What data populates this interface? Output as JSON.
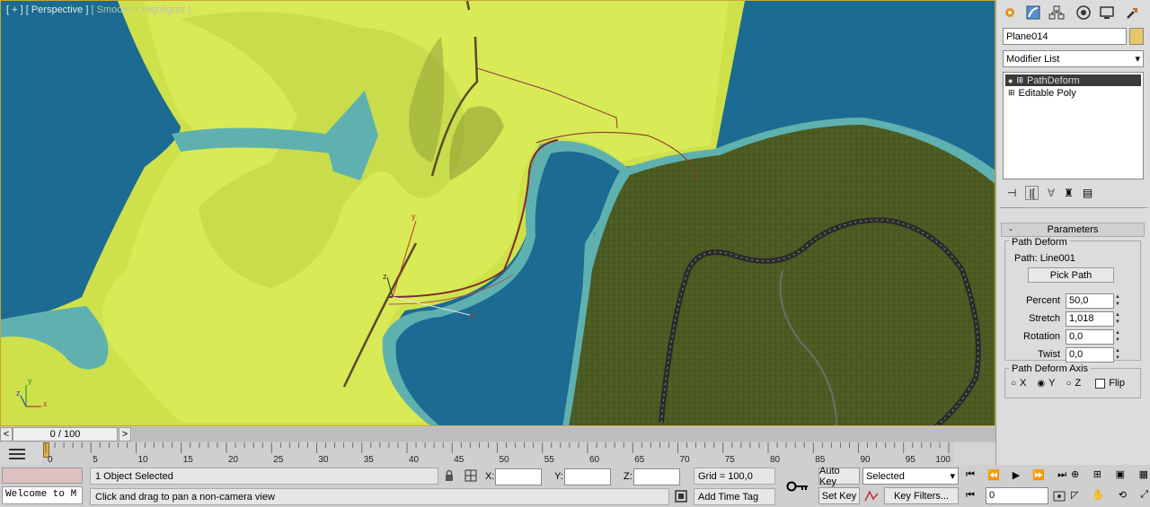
{
  "viewport": {
    "label_plus": "[ + ]",
    "label_view": "[ Perspective ]",
    "label_shading": "[ Smooth + Highlights ]",
    "axis": {
      "x": "x",
      "y": "y",
      "z": "z"
    },
    "gizmo": {
      "x": "x",
      "y": "y",
      "z": "z"
    }
  },
  "command_panel": {
    "object_name": "Plane014",
    "object_color": "#e6c86a",
    "modifier_list": "Modifier List",
    "stack": [
      {
        "label": "PathDeform",
        "selected": true
      },
      {
        "label": "Editable Poly",
        "selected": false
      }
    ],
    "rollout": {
      "title": "Parameters",
      "collapse": "-",
      "group1": "Path Deform",
      "path_label": "Path: Line001",
      "pick_path": "Pick Path",
      "params": [
        {
          "label": "Percent",
          "value": "50,0"
        },
        {
          "label": "Stretch",
          "value": "1,018"
        },
        {
          "label": "Rotation",
          "value": "0,0"
        },
        {
          "label": "Twist",
          "value": "0,0"
        }
      ],
      "group2": "Path Deform Axis",
      "axes": [
        {
          "label": "X",
          "checked": false
        },
        {
          "label": "Y",
          "checked": true
        },
        {
          "label": "Z",
          "checked": false
        }
      ],
      "flip": "Flip"
    }
  },
  "timeline": {
    "frame": "0 / 100",
    "prev": "<",
    "next": ">",
    "ticks": [
      "0",
      "5",
      "10",
      "15",
      "20",
      "25",
      "30",
      "35",
      "40",
      "45",
      "50",
      "55",
      "60",
      "65",
      "70",
      "75",
      "80",
      "85",
      "90",
      "95",
      "100"
    ]
  },
  "status": {
    "maxscript": "Welcome to M",
    "selected": "1 Object Selected",
    "prompt": "Click and drag to pan a non-camera view",
    "x_label": "X:",
    "y_label": "Y:",
    "z_label": "Z:",
    "grid": "Grid = 100,0",
    "add_time_tag": "Add Time Tag",
    "auto_key": "Auto Key",
    "set_key": "Set Key",
    "key_mode": "Selected",
    "key_filters": "Key Filters...",
    "current_frame": "0"
  }
}
